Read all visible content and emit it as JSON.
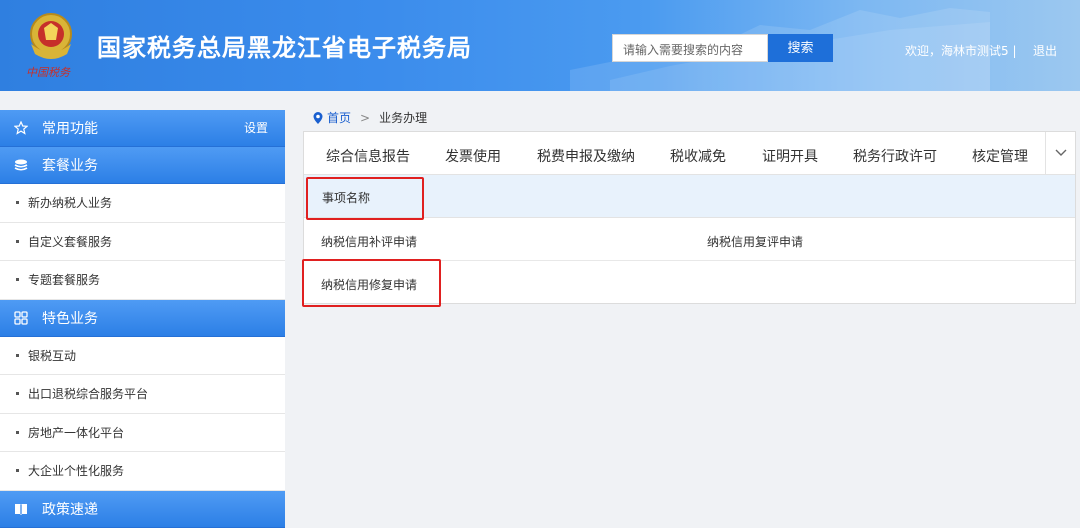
{
  "header": {
    "title": "国家税务总局黑龙江省电子税务局",
    "search_placeholder": "请输入需要搜索的内容",
    "search_button": "搜索",
    "welcome": "欢迎，海林市测试5 |",
    "logout": "退出",
    "logo_text": "中国税务"
  },
  "sidebar": {
    "favorites": {
      "label": "常用功能",
      "setting": "设置"
    },
    "packages": {
      "label": "套餐业务",
      "items": [
        "新办纳税人业务",
        "自定义套餐服务",
        "专题套餐服务"
      ]
    },
    "special": {
      "label": "特色业务",
      "items": [
        "银税互动",
        "出口退税综合服务平台",
        "房地产一体化平台",
        "大企业个性化服务"
      ]
    },
    "policy": {
      "label": "政策速递"
    }
  },
  "breadcrumb": {
    "home": "首页",
    "separator": ">",
    "current": "业务办理"
  },
  "tabs": [
    "综合信息报告",
    "发票使用",
    "税费申报及缴纳",
    "税收减免",
    "证明开具",
    "税务行政许可",
    "核定管理"
  ],
  "table": {
    "header": "事项名称",
    "rows": [
      [
        "纳税信用补评申请",
        "纳税信用复评申请"
      ],
      [
        "纳税信用修复申请"
      ]
    ]
  },
  "colors": {
    "accent": "#2c7fe6",
    "highlight": "#e02020",
    "table_header_bg": "#e8f2fc"
  }
}
